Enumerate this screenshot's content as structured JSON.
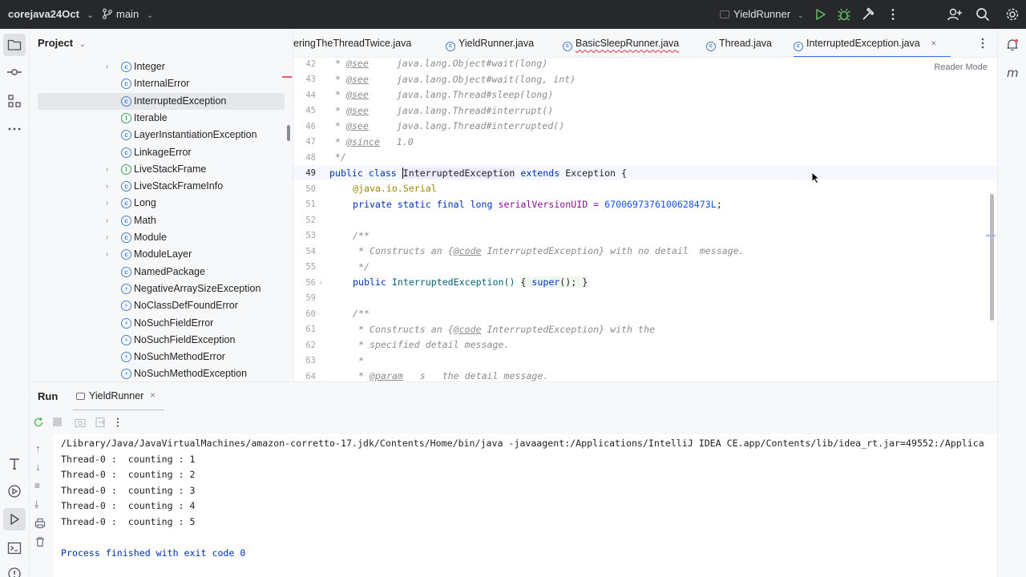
{
  "titlebar": {
    "project": "corejava24Oct",
    "branch": "main",
    "run_config": "YieldRunner"
  },
  "project_panel": {
    "title": "Project",
    "items": [
      {
        "label": "Integer",
        "kind": "class",
        "expandable": true
      },
      {
        "label": "InternalError",
        "kind": "class",
        "expandable": false
      },
      {
        "label": "InterruptedException",
        "kind": "class",
        "expandable": false,
        "selected": true
      },
      {
        "label": "Iterable",
        "kind": "interface",
        "expandable": false
      },
      {
        "label": "LayerInstantiationException",
        "kind": "class",
        "expandable": false
      },
      {
        "label": "LinkageError",
        "kind": "class",
        "expandable": false
      },
      {
        "label": "LiveStackFrame",
        "kind": "interface",
        "expandable": true
      },
      {
        "label": "LiveStackFrameInfo",
        "kind": "class",
        "expandable": true
      },
      {
        "label": "Long",
        "kind": "class",
        "expandable": true
      },
      {
        "label": "Math",
        "kind": "class",
        "expandable": true
      },
      {
        "label": "Module",
        "kind": "class",
        "expandable": true
      },
      {
        "label": "ModuleLayer",
        "kind": "class",
        "expandable": true
      },
      {
        "label": "NamedPackage",
        "kind": "class",
        "expandable": false
      },
      {
        "label": "NegativeArraySizeException",
        "kind": "exception",
        "expandable": false
      },
      {
        "label": "NoClassDefFoundError",
        "kind": "exception",
        "expandable": false
      },
      {
        "label": "NoSuchFieldError",
        "kind": "exception",
        "expandable": false
      },
      {
        "label": "NoSuchFieldException",
        "kind": "exception",
        "expandable": false
      },
      {
        "label": "NoSuchMethodError",
        "kind": "exception",
        "expandable": false
      },
      {
        "label": "NoSuchMethodException",
        "kind": "exception",
        "expandable": false
      }
    ]
  },
  "editor_tabs": [
    {
      "label": "eringTheThreadTwice.java",
      "partial": true
    },
    {
      "label": "YieldRunner.java"
    },
    {
      "label": "BasicSleepRunner.java",
      "error": true
    },
    {
      "label": "Thread.java"
    },
    {
      "label": "InterruptedException.java",
      "active": true
    }
  ],
  "editor": {
    "reader_mode": "Reader Mode",
    "line_numbers": [
      "42",
      "43",
      "44",
      "45",
      "46",
      "47",
      "48",
      "49",
      "50",
      "51",
      "52",
      "53",
      "54",
      "55",
      "56",
      "59",
      "60",
      "61",
      "62",
      "63",
      "64"
    ],
    "doc_lines": {
      "l42": {
        "tag": "@see",
        "text": "     java.lang.Object#wait(long)"
      },
      "l43": {
        "tag": "@see",
        "text": "     java.lang.Object#wait(long, int)"
      },
      "l44": {
        "tag": "@see",
        "text": "     java.lang.Thread#sleep(long)"
      },
      "l45": {
        "tag": "@see",
        "text": "     java.lang.Thread#interrupt()"
      },
      "l46": {
        "tag": "@see",
        "text": "     java.lang.Thread#interrupted()"
      },
      "l47": {
        "tag": "@since",
        "text": "   1.0"
      }
    },
    "l48": " */",
    "l49": {
      "kw1": "public",
      "kw2": "class",
      "name": "InterruptedException",
      "kw3": "extends",
      "rest": "Exception {"
    },
    "l50": "@java.io.Serial",
    "l51": {
      "kw": "private static final long",
      "field": "serialVersionUID =",
      "num": "6700697376100628473L",
      "end": ";"
    },
    "l53": "/**",
    "l54": {
      "pre": " * Constructs an {",
      "code": "@code",
      "post": " InterruptedException} with no detail  message."
    },
    "l55": " */",
    "l56": {
      "kw1": "public",
      "rest": "InterruptedException()",
      "body": "{ ",
      "kw2": "super",
      "tail": "(); }"
    },
    "l60": "/**",
    "l61": {
      "pre": " * Constructs an {",
      "code": "@code",
      "post": " InterruptedException} with the"
    },
    "l62": " * specified detail message.",
    "l63": " *",
    "l64": {
      "tag": "@param",
      "text": "   s   the detail message."
    }
  },
  "run_panel": {
    "title": "Run",
    "tab": "YieldRunner",
    "command": "/Library/Java/JavaVirtualMachines/amazon-corretto-17.jdk/Contents/Home/bin/java -javaagent:/Applications/IntelliJ IDEA CE.app/Contents/lib/idea_rt.jar=49552:/Applica",
    "output": [
      "Thread-0 :  counting : 1",
      "Thread-0 :  counting : 2",
      "Thread-0 :  counting : 3",
      "Thread-0 :  counting : 4",
      "Thread-0 :  counting : 5"
    ],
    "finish": "Process finished with exit code 0"
  }
}
